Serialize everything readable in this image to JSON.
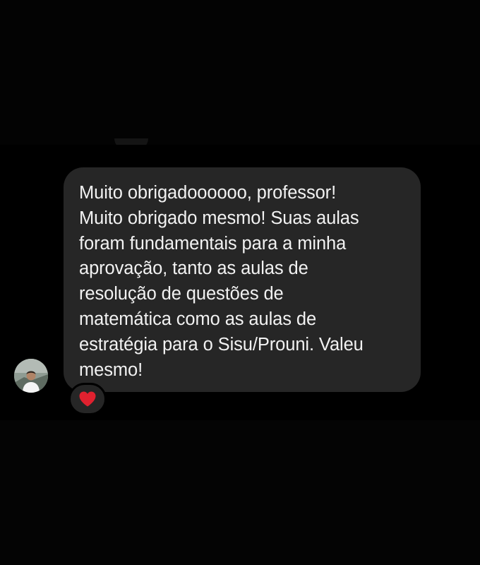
{
  "message": {
    "text": "Muito obrigadoooooo, professor!\nMuito obrigado mesmo! Suas aulas\nforam fundamentais para a minha\naprovação, tanto as aulas de\nresolução de questões de\nmatemática como as aulas de\nestratégia para o Sisu/Prouni. Valeu\nmesmo!"
  },
  "reaction": {
    "icon": "heart-icon",
    "color": "#e0212f"
  },
  "avatar": {
    "icon": "user-photo"
  },
  "colors": {
    "background": "#000000",
    "bubble": "#262626",
    "text": "#f2f2f2"
  }
}
